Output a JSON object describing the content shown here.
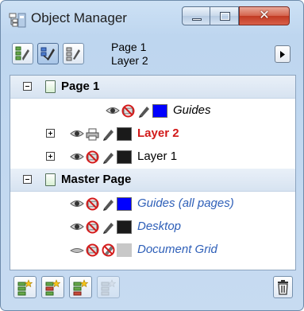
{
  "window": {
    "title": "Object Manager",
    "close_glyph": "✕"
  },
  "toolbar": {
    "buttons": [
      {
        "icon": "show-object-properties-icon",
        "active": false
      },
      {
        "icon": "edit-across-layers-icon",
        "active": true
      },
      {
        "icon": "layer-manager-view-icon",
        "active": false
      }
    ],
    "current_page": "Page 1",
    "current_layer": "Layer 2",
    "menu_arrow_icon": "flyout-arrow-icon"
  },
  "tree": {
    "page1": {
      "label": "Page 1",
      "layers": [
        {
          "name": "Guides",
          "style": "italic-blue",
          "visible": true,
          "printable": false,
          "editable": true,
          "color": "#0000ff"
        },
        {
          "name": "Layer 2",
          "style": "bold-red",
          "visible": true,
          "printable": true,
          "editable": true,
          "color": "#1a1a1a",
          "active": true
        },
        {
          "name": "Layer 1",
          "style": "normal",
          "visible": true,
          "printable": false,
          "editable": true,
          "color": "#1a1a1a"
        }
      ]
    },
    "master": {
      "label": "Master Page",
      "layers": [
        {
          "name": "Guides (all pages)",
          "style": "italic-blue",
          "visible": true,
          "printable": false,
          "editable": true,
          "color": "#0000ff"
        },
        {
          "name": "Desktop",
          "style": "italic-blue",
          "visible": true,
          "printable": false,
          "editable": true,
          "color": "#1a1a1a"
        },
        {
          "name": "Document Grid",
          "style": "italic-blue",
          "visible": false,
          "printable": false,
          "editable": false,
          "color": "#c8c8c8"
        }
      ]
    }
  },
  "bottom_toolbar": {
    "buttons": [
      "new-layer-icon",
      "new-master-layer-icon",
      "new-master-layer-all-pages-icon",
      "new-master-layer-disabled-icon"
    ],
    "delete_icon": "trash-icon"
  }
}
